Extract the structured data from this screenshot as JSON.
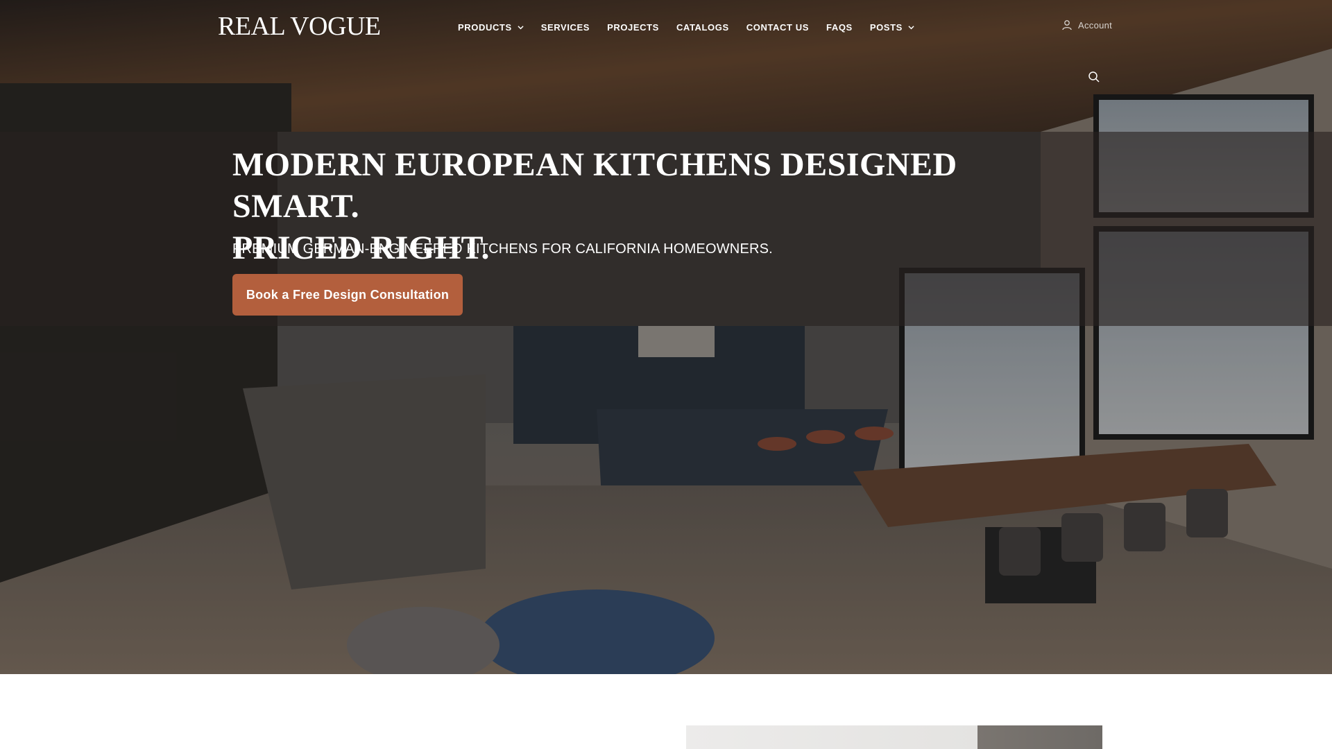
{
  "header": {
    "logo_text": "REAL VOGUE",
    "nav": [
      {
        "label": "PRODUCTS",
        "has_dropdown": true
      },
      {
        "label": "SERVICES",
        "has_dropdown": false
      },
      {
        "label": "PROJECTS",
        "has_dropdown": false
      },
      {
        "label": "CATALOGS",
        "has_dropdown": false
      },
      {
        "label": "CONTACT US",
        "has_dropdown": false
      },
      {
        "label": "FAQS",
        "has_dropdown": false
      },
      {
        "label": "POSTS",
        "has_dropdown": true
      }
    ],
    "account_label": "Account",
    "icons": {
      "account": "user-icon",
      "search": "search-icon",
      "dropdown": "chevron-down-icon"
    }
  },
  "hero": {
    "headline_line1": "MODERN EUROPEAN KITCHENS DESIGNED SMART.",
    "headline_line2": "PRICED RIGHT.",
    "subheadline": "PREMIUM GERMAN-ENGINEERED KITCHENS FOR CALIFORNIA HOMEOWNERS.",
    "cta_label": "Book a Free Design Consultation"
  },
  "colors": {
    "cta_background": "#b35f3d",
    "text": "#ffffff",
    "band_overlay": "rgba(40,34,32,0.62)"
  }
}
